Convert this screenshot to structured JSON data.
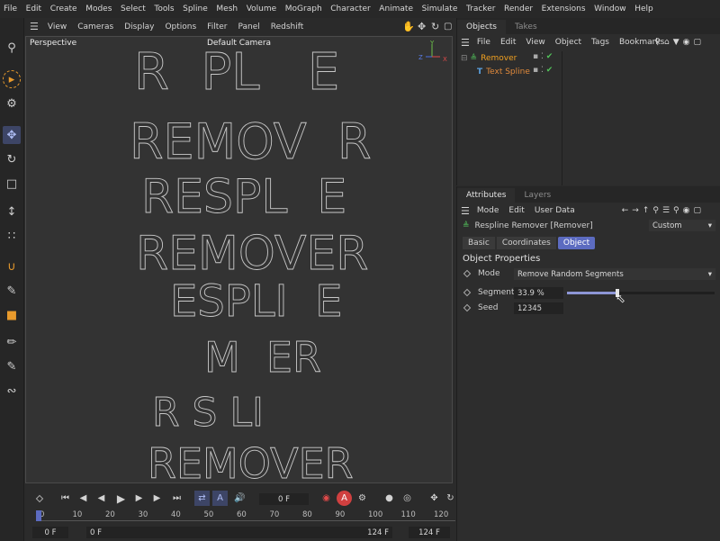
{
  "menubar": [
    "File",
    "Edit",
    "Create",
    "Modes",
    "Select",
    "Tools",
    "Spline",
    "Mesh",
    "Volume",
    "MoGraph",
    "Character",
    "Animate",
    "Simulate",
    "Tracker",
    "Render",
    "Extensions",
    "Window",
    "Help"
  ],
  "viewport": {
    "menu": [
      "View",
      "Cameras",
      "Display",
      "Options",
      "Filter",
      "Panel",
      "Redshift"
    ],
    "name": "Perspective",
    "camera": "Default Camera",
    "axes": {
      "y": "Y",
      "z": "Z",
      "x": "X"
    },
    "lines": [
      "R  PL   E",
      "REMOV  R",
      "RESPL  E",
      "REMOVER",
      "ESPLI  E",
      "M  ER",
      "R S LI",
      "REMOVER"
    ]
  },
  "objects": {
    "tabs": [
      "Objects",
      "Takes"
    ],
    "menu": [
      "File",
      "Edit",
      "View",
      "Object",
      "Tags",
      "Bookmarks"
    ],
    "items": [
      {
        "name": "Remover",
        "color": "#f0a020"
      },
      {
        "name": "Text Spline",
        "color": "#e08a3c"
      }
    ]
  },
  "attributes": {
    "tabs": [
      "Attributes",
      "Layers"
    ],
    "menu": [
      "Mode",
      "Edit",
      "User Data"
    ],
    "object_name": "Respline Remover [Remover]",
    "preset": "Custom",
    "subtabs": [
      "Basic",
      "Coordinates",
      "Object"
    ],
    "section": "Object Properties",
    "mode_label": "Mode",
    "mode_value": "Remove Random Segments",
    "segments_label": "Segments",
    "segments_value": "33.9 %",
    "segments_fraction": 0.339,
    "seed_label": "Seed",
    "seed_value": "12345"
  },
  "timeline": {
    "current_frame": "0 F",
    "ticks": [
      "0",
      "10",
      "20",
      "30",
      "40",
      "50",
      "60",
      "70",
      "80",
      "90",
      "100",
      "110",
      "120"
    ],
    "start": "0 F",
    "min": "0 F",
    "max": "124 F",
    "end": "124 F",
    "accent": "#5c6bc0"
  },
  "icons": {
    "left": [
      "search-icon",
      "selection-icon",
      "settings-icon",
      "move-icon",
      "rotate-icon",
      "scale-icon",
      "snap-icon",
      "points-icon",
      "bend-icon",
      "pen-icon",
      "knife-icon",
      "brush-icon",
      "paint-icon",
      "spline-icon"
    ]
  }
}
